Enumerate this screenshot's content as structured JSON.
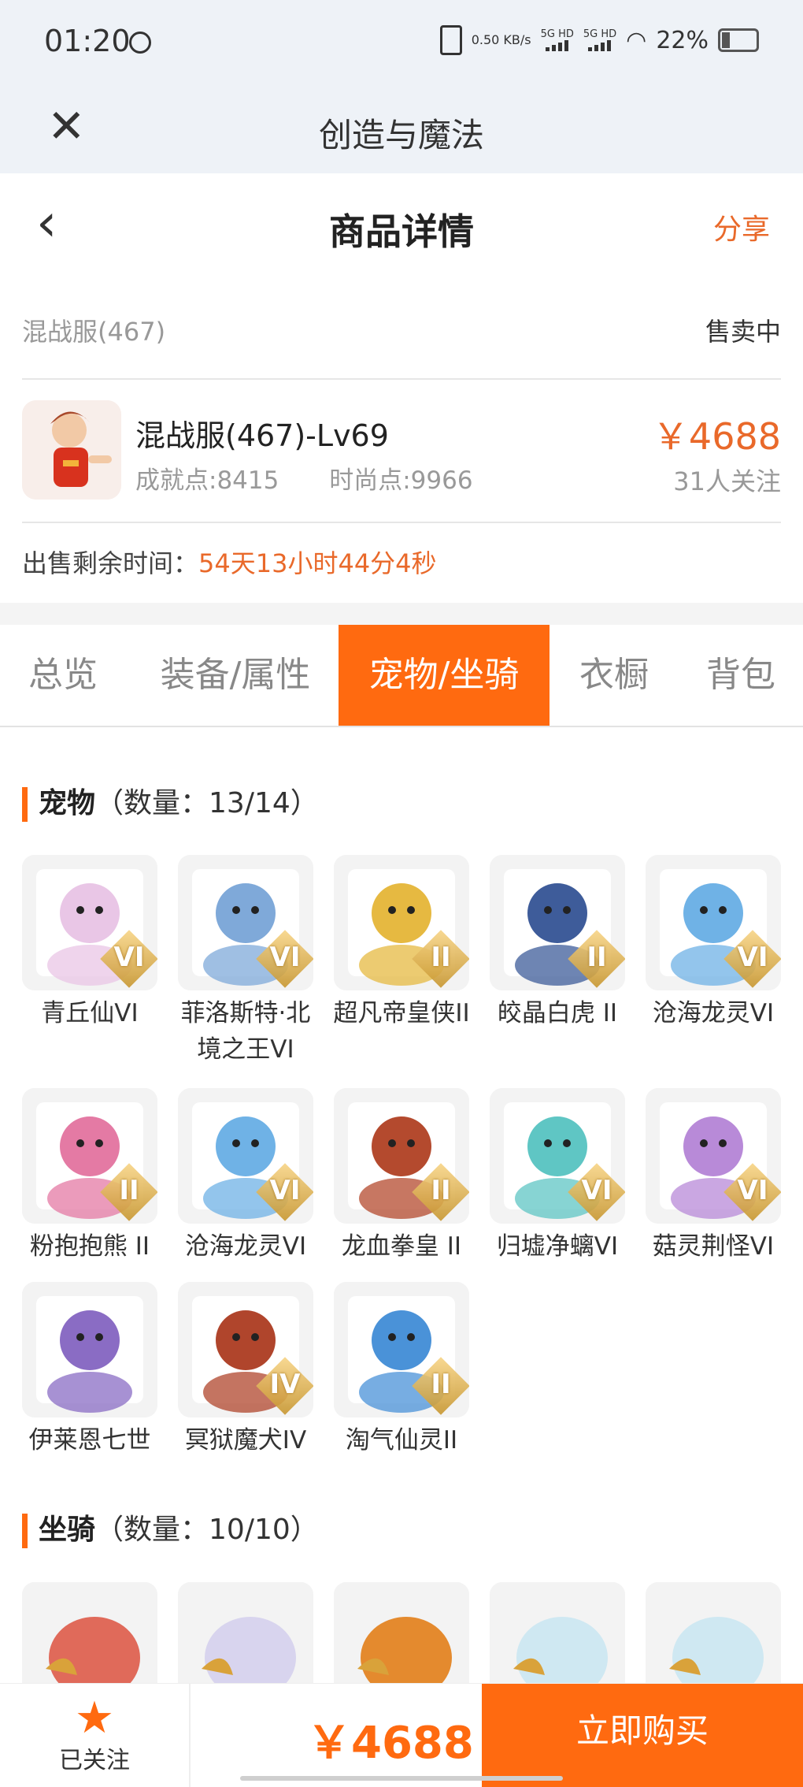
{
  "status_bar": {
    "time": "01:20",
    "speed": "0.50 KB/s",
    "net1": "5G HD",
    "net2": "5G HD",
    "battery": "22%"
  },
  "app_bar": {
    "title": "创造与魔法"
  },
  "nav": {
    "title": "商品详情",
    "share": "分享"
  },
  "listing": {
    "server": "混战服(467)",
    "status": "售卖中",
    "name": "混战服(467)-Lv69",
    "achievement": "成就点:8415",
    "fashion": "时尚点:9966",
    "price": "￥4688",
    "followers": "31人关注",
    "remain_label": "出售剩余时间：",
    "remain_value": "54天13小时44分4秒"
  },
  "tabs": [
    "总览",
    "装备/属性",
    "宠物/坐骑",
    "衣橱",
    "背包"
  ],
  "pets": {
    "title": "宠物",
    "count": "（数量：13/14）",
    "items": [
      {
        "name": "青丘仙VI",
        "tier": "VI",
        "color": "#e9c6e6"
      },
      {
        "name": "菲洛斯特·北境之王VI",
        "tier": "VI",
        "color": "#7fa9d9"
      },
      {
        "name": "超凡帝皇侠II",
        "tier": "II",
        "color": "#e6b941"
      },
      {
        "name": "皎晶白虎 II",
        "tier": "II",
        "color": "#3e5c9a"
      },
      {
        "name": "沧海龙灵VI",
        "tier": "VI",
        "color": "#6fb2e6"
      },
      {
        "name": "粉抱抱熊 II",
        "tier": "II",
        "color": "#e47aa4"
      },
      {
        "name": "沧海龙灵VI",
        "tier": "VI",
        "color": "#6fb2e6"
      },
      {
        "name": "龙血拳皇 II",
        "tier": "II",
        "color": "#b44a2e"
      },
      {
        "name": "归墟净螭VI",
        "tier": "VI",
        "color": "#5fc6c4"
      },
      {
        "name": "菇灵荆怪VI",
        "tier": "VI",
        "color": "#b88ad8"
      },
      {
        "name": "伊莱恩七世",
        "tier": "",
        "color": "#8a6cc4"
      },
      {
        "name": "冥狱魔犬IV",
        "tier": "IV",
        "color": "#b0452c"
      },
      {
        "name": "淘气仙灵II",
        "tier": "II",
        "color": "#4a92d8"
      }
    ]
  },
  "mounts": {
    "title": "坐骑",
    "count": "（数量：10/10）",
    "items": [
      {
        "color": "#e06a5a"
      },
      {
        "color": "#d8d4ee"
      },
      {
        "color": "#e48a2e"
      },
      {
        "color": "#cfe8f2"
      },
      {
        "color": "#cfe8f2"
      }
    ]
  },
  "bottom": {
    "follow": "已关注",
    "price": "￥4688",
    "buy": "立即购买"
  },
  "colors": {
    "accent": "#ff6a10",
    "price": "#e9692a"
  }
}
